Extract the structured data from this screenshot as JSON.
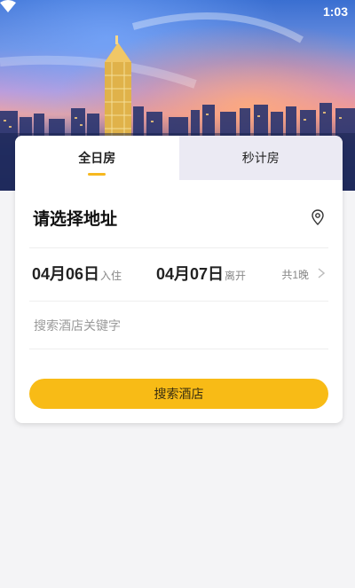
{
  "status_bar": {
    "time": "1:03",
    "wifi_icon": "wifi-icon"
  },
  "tabs": [
    {
      "label": "全日房",
      "active": true
    },
    {
      "label": "秒计房",
      "active": false
    }
  ],
  "address": {
    "label": "请选择地址",
    "icon": "location-pin-icon"
  },
  "dates": {
    "checkin_date": "04月06日",
    "checkin_label": "入住",
    "checkout_date": "04月07日",
    "checkout_label": "离开",
    "nights": "共1晚"
  },
  "search": {
    "placeholder": "搜索酒店关键字",
    "value": ""
  },
  "search_button": {
    "label": "搜索酒店"
  },
  "colors": {
    "accent": "#f8bb16",
    "inactive_tab": "#ebeaf3",
    "background": "#f4f4f6"
  }
}
